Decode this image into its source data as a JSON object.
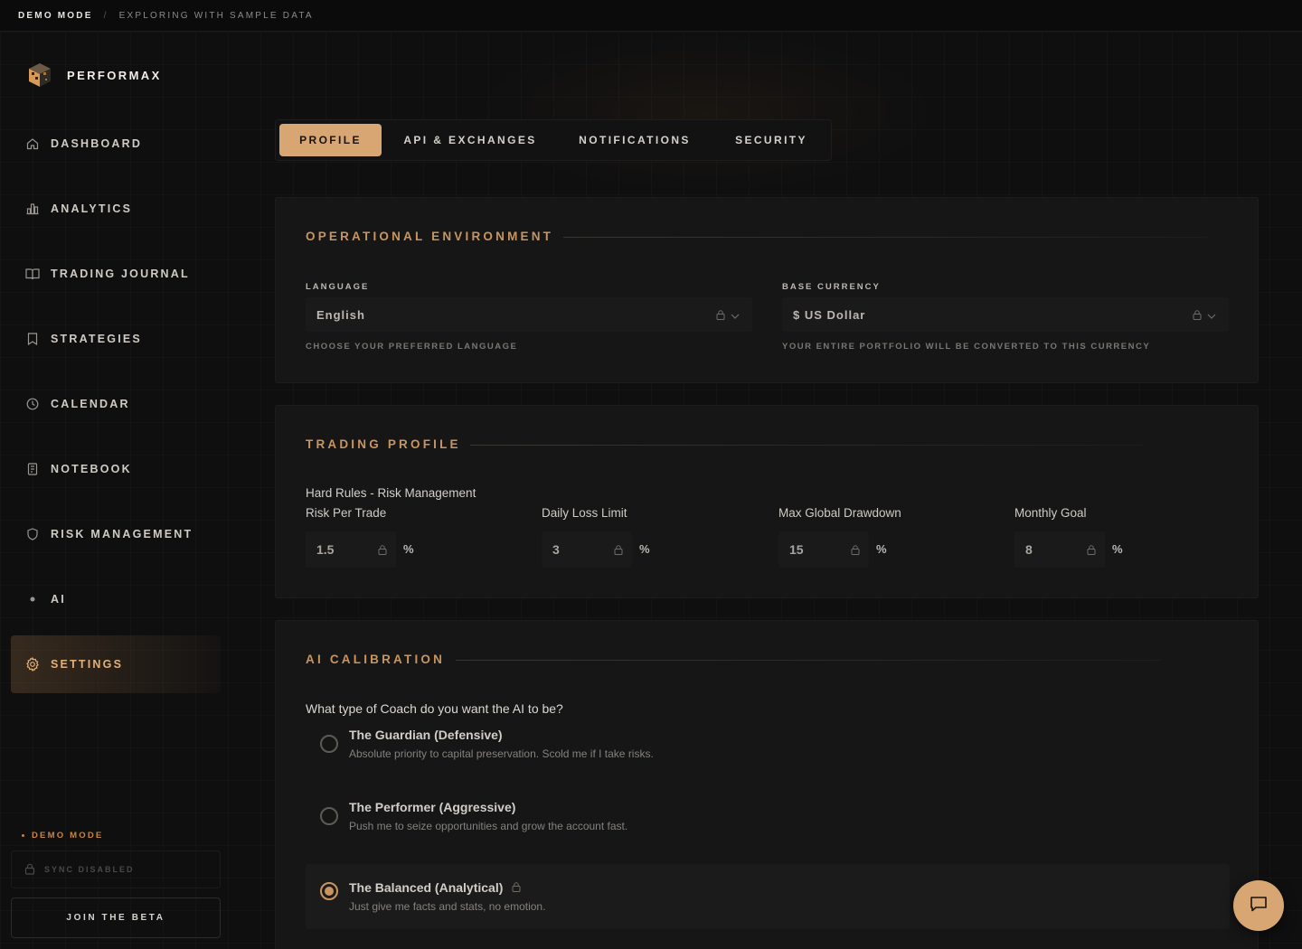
{
  "topbar": {
    "demo_mode": "DEMO MODE",
    "separator": "/",
    "exploring": "EXPLORING WITH SAMPLE DATA"
  },
  "brand": {
    "name": "PERFORMAX",
    "logo_icon": "cube-logo-icon"
  },
  "sidebar": {
    "items": [
      {
        "label": "DASHBOARD",
        "icon": "home-icon"
      },
      {
        "label": "ANALYTICS",
        "icon": "bar-chart-icon"
      },
      {
        "label": "TRADING JOURNAL",
        "icon": "book-open-icon"
      },
      {
        "label": "STRATEGIES",
        "icon": "bookmark-icon"
      },
      {
        "label": "CALENDAR",
        "icon": "clock-icon"
      },
      {
        "label": "NOTEBOOK",
        "icon": "notebook-icon"
      },
      {
        "label": "RISK MANAGEMENT",
        "icon": "shield-icon"
      },
      {
        "label": "AI",
        "icon": "dot-icon"
      },
      {
        "label": "SETTINGS",
        "icon": "gear-icon",
        "active": true
      }
    ],
    "demo_mode": "DEMO MODE",
    "sync_status": "SYNC DISABLED",
    "join_beta": "JOIN THE BETA"
  },
  "tabs": [
    {
      "label": "PROFILE",
      "active": true
    },
    {
      "label": "API & EXCHANGES"
    },
    {
      "label": "NOTIFICATIONS"
    },
    {
      "label": "SECURITY"
    }
  ],
  "operational": {
    "title": "OPERATIONAL ENVIRONMENT",
    "language_label": "LANGUAGE",
    "language_value": "English",
    "language_hint": "CHOOSE YOUR PREFERRED LANGUAGE",
    "currency_label": "BASE CURRENCY",
    "currency_value": "$ US Dollar",
    "currency_hint": "YOUR ENTIRE PORTFOLIO WILL BE CONVERTED TO THIS CURRENCY"
  },
  "trading_profile": {
    "title": "TRADING PROFILE",
    "rules_heading": "Hard Rules - Risk Management",
    "fields": [
      {
        "label": "Risk Per Trade",
        "value": "1.5",
        "unit": "%"
      },
      {
        "label": "Daily Loss Limit",
        "value": "3",
        "unit": "%"
      },
      {
        "label": "Max Global Drawdown",
        "value": "15",
        "unit": "%"
      },
      {
        "label": "Monthly Goal",
        "value": "8",
        "unit": "%"
      }
    ]
  },
  "ai_calibration": {
    "title": "AI CALIBRATION",
    "question": "What type of Coach do you want the AI to be?",
    "options": [
      {
        "title": "The Guardian (Defensive)",
        "desc": "Absolute priority to capital preservation. Scold me if I take risks.",
        "selected": false
      },
      {
        "title": "The Performer (Aggressive)",
        "desc": "Push me to seize opportunities and grow the account fast.",
        "selected": false
      },
      {
        "title": "The Balanced (Analytical)",
        "desc": "Just give me facts and stats, no emotion.",
        "selected": true
      }
    ]
  },
  "colors": {
    "accent": "#d7a673",
    "accent_text": "#c9955f",
    "background": "#0f0f10",
    "card": "#161617"
  },
  "chat_button": {
    "icon": "chat-bubble-icon"
  }
}
